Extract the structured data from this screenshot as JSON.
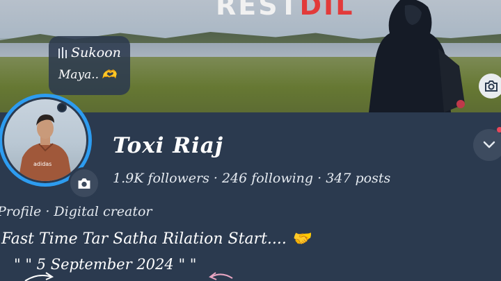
{
  "cover": {
    "overlay_text_white": "REST",
    "overlay_text_red": "DIL",
    "camera_icon": "camera-icon"
  },
  "music": {
    "line1": "Sukoon",
    "line2": "Maya..",
    "emoji": "🫶",
    "icon": "audio-bars-icon"
  },
  "profile": {
    "name": "Toxi Riaj",
    "stats": "1.9K followers · 246 following · 347 posts",
    "category": "Profile · Digital creator",
    "bio_line1": "Fast Time Tar Satha Rilation Start.... 🤝",
    "bio_line2": "\"  \"   5 September 2024   \"  \""
  },
  "colors": {
    "panel": "#2b3a4f",
    "story_ring": "#2d9cf0",
    "notification": "#e8485a"
  }
}
